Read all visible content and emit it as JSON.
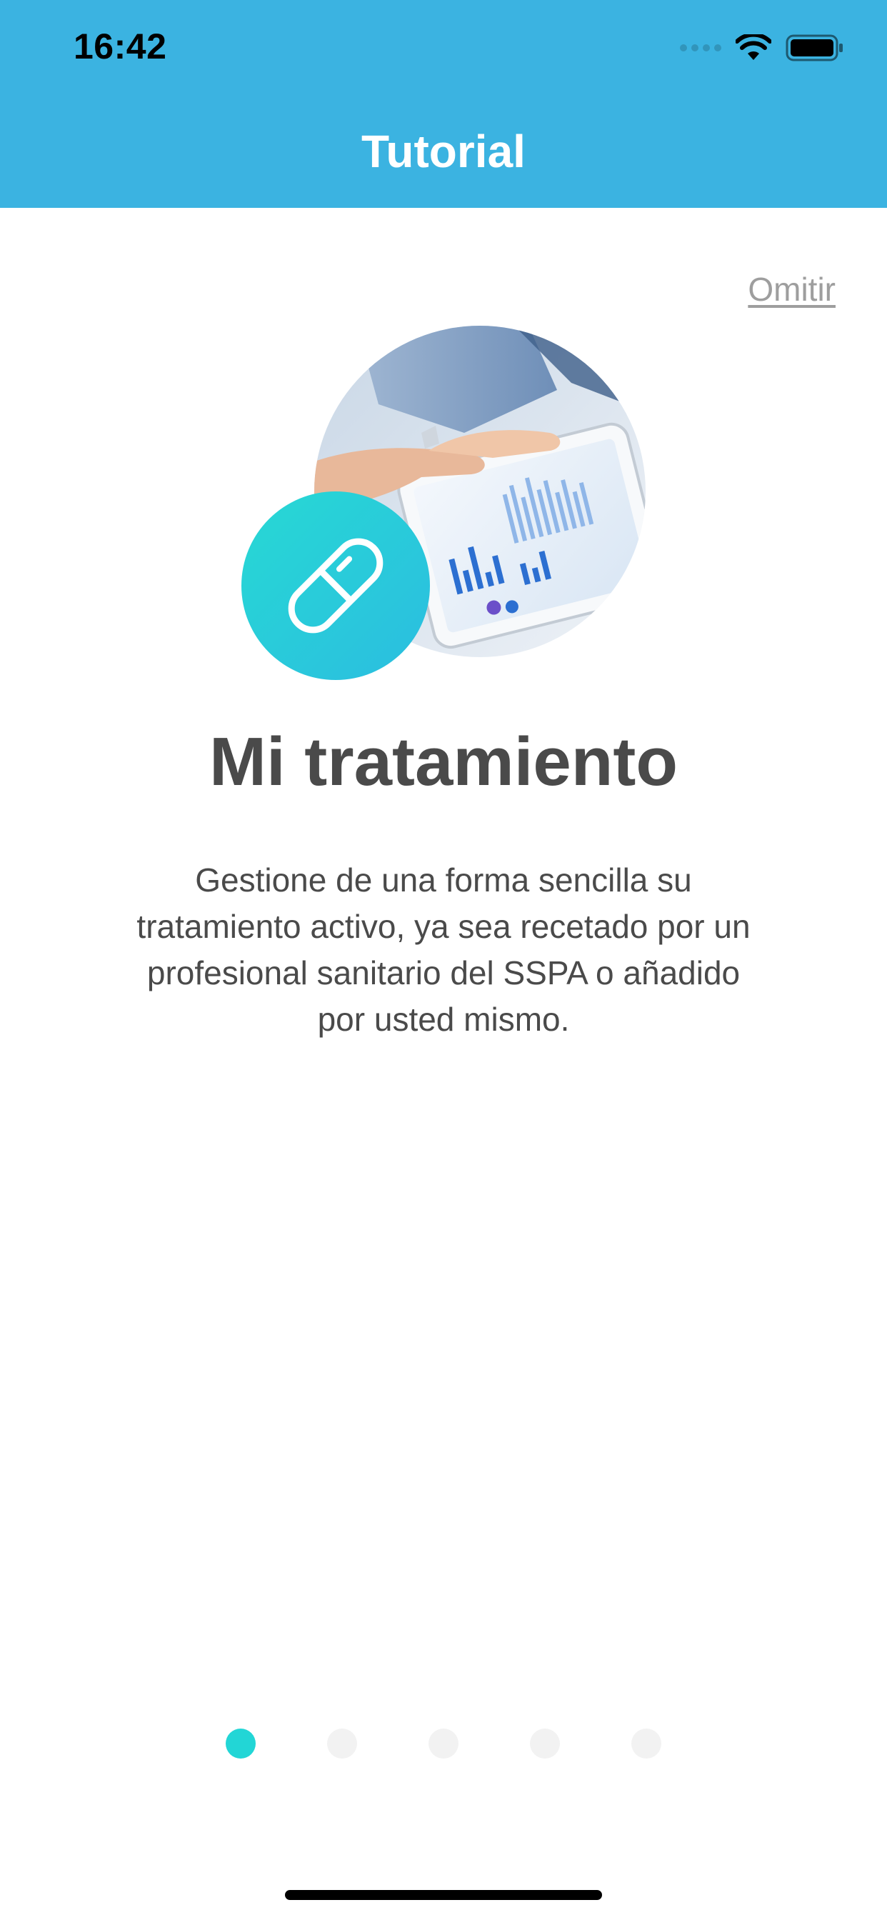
{
  "status_bar": {
    "time": "16:42"
  },
  "header": {
    "title": "Tutorial",
    "background_color": "#3bb3e1"
  },
  "skip": {
    "label": "Omitir"
  },
  "illustration": {
    "photo_icon": "tablet-chart-photo",
    "badge_icon": "pill-icon",
    "badge_color": "#27d9d4"
  },
  "slide": {
    "title": "Mi tratamiento",
    "description": "Gestione de una forma sencilla su tratamiento activo, ya sea recetado por un profesional sanitario del SSPA o añadido por usted mismo."
  },
  "pager": {
    "total": 5,
    "current": 1,
    "active_color": "#22d6d6"
  }
}
